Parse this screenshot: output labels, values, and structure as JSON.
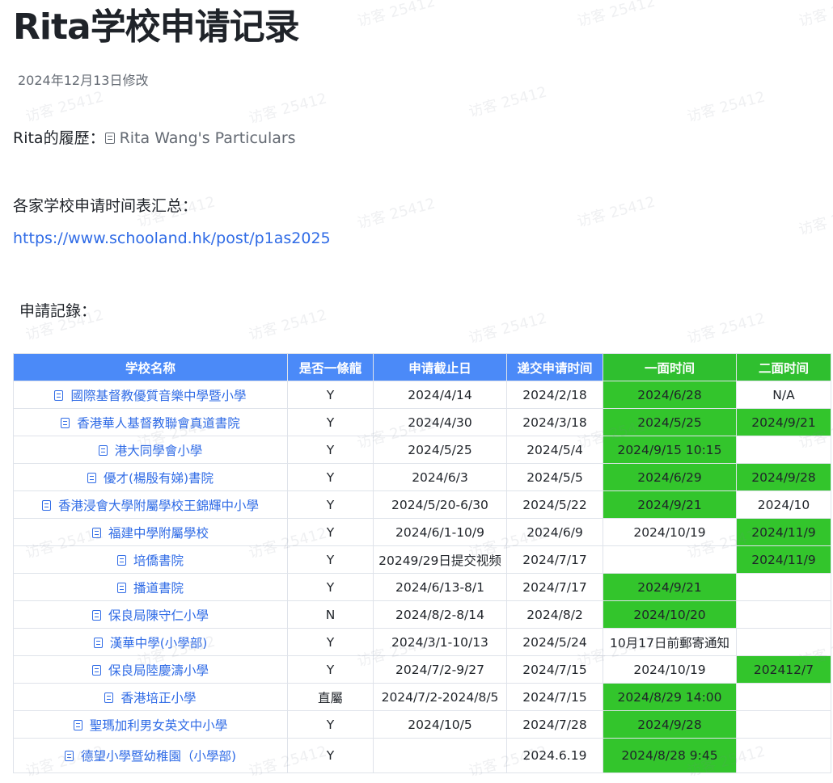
{
  "page": {
    "title": "Rita学校申请记录",
    "modified": "2024年12月13日修改",
    "resume_label": "Rita的履歷：",
    "resume_link": "Rita Wang's Particulars",
    "summary_label": "各家学校申请时间表汇总：",
    "summary_url": "https://www.schooland.hk/post/p1as2025",
    "records_label": "申請記錄："
  },
  "watermark": "访客 25412",
  "colors": {
    "header_blue": "#4b8af8",
    "header_green": "#2fbf2f",
    "cell_green": "#33c52c",
    "link_blue": "#2f6be6"
  },
  "table": {
    "headers": [
      "学校名称",
      "是否一條龍",
      "申请截止日",
      "递交申请时间",
      "一面时间",
      "二面时间"
    ],
    "rows": [
      {
        "school": "國際基督教優質音樂中學暨小學",
        "through": "Y",
        "deadline": "2024/4/14",
        "submitted": "2024/2/18",
        "interview1": "2024/6/28",
        "interview2": "N/A",
        "g1": true,
        "g2": false
      },
      {
        "school": "香港華人基督教聯會真道書院",
        "through": "Y",
        "deadline": "2024/4/30",
        "submitted": "2024/3/18",
        "interview1": "2024/5/25",
        "interview2": "2024/9/21",
        "g1": true,
        "g2": true
      },
      {
        "school": "港大同學會小學",
        "through": "Y",
        "deadline": "2024/5/25",
        "submitted": "2024/5/4",
        "interview1": "2024/9/15 10:15",
        "interview2": "",
        "g1": true,
        "g2": false
      },
      {
        "school": "優才(楊殷有娣)書院",
        "through": "Y",
        "deadline": "2024/6/3",
        "submitted": "2024/5/5",
        "interview1": "2024/6/29",
        "interview2": "2024/9/28",
        "g1": true,
        "g2": true
      },
      {
        "school": "香港浸會大學附屬學校王錦輝中小學",
        "through": "Y",
        "deadline": "2024/5/20-6/30",
        "submitted": "2024/5/22",
        "interview1": "2024/9/21",
        "interview2": "2024/10",
        "g1": true,
        "g2": false
      },
      {
        "school": "福建中學附屬學校",
        "through": "Y",
        "deadline": "2024/6/1-10/9",
        "submitted": "2024/6/9",
        "interview1": "2024/10/19",
        "interview2": "2024/11/9",
        "g1": false,
        "g2": true
      },
      {
        "school": "培僑書院",
        "through": "Y",
        "deadline": "20249/29日提交视频",
        "submitted": "2024/7/17",
        "interview1": "",
        "interview2": "2024/11/9",
        "g1": false,
        "g2": true
      },
      {
        "school": "播道書院",
        "through": "Y",
        "deadline": "2024/6/13-8/1",
        "submitted": "2024/7/17",
        "interview1": "2024/9/21",
        "interview2": "",
        "g1": true,
        "g2": false
      },
      {
        "school": "保良局陳守仁小學",
        "through": "N",
        "deadline": "2024/8/2-8/14",
        "submitted": "2024/8/2",
        "interview1": "2024/10/20",
        "interview2": "",
        "g1": true,
        "g2": false
      },
      {
        "school": "漢華中學(小學部)",
        "through": "Y",
        "deadline": "2024/3/1-10/13",
        "submitted": "2024/5/24",
        "interview1": "10月17日前郵寄通知",
        "interview2": "",
        "g1": false,
        "g2": false
      },
      {
        "school": "保良局陸慶濤小學",
        "through": "Y",
        "deadline": "2024/7/2-9/27",
        "submitted": "2024/7/15",
        "interview1": "2024/10/19",
        "interview2": "202412/7",
        "g1": false,
        "g2": true
      },
      {
        "school": "香港培正小學",
        "through": "直屬",
        "deadline": "2024/7/2-2024/8/5",
        "submitted": "2024/7/15",
        "interview1": "2024/8/29 14:00",
        "interview2": "",
        "g1": true,
        "g2": false
      },
      {
        "school": "聖瑪加利男女英文中小學",
        "through": "Y",
        "deadline": "2024/10/5",
        "submitted": "2024/7/28",
        "interview1": "2024/9/28",
        "interview2": "",
        "g1": true,
        "g2": false
      },
      {
        "school": "德望小學暨幼稚園（小學部)",
        "through": "Y",
        "deadline": "",
        "submitted": "2024.6.19",
        "interview1": "2024/8/28 9:45",
        "interview2": "",
        "g1": true,
        "g2": false
      }
    ]
  }
}
